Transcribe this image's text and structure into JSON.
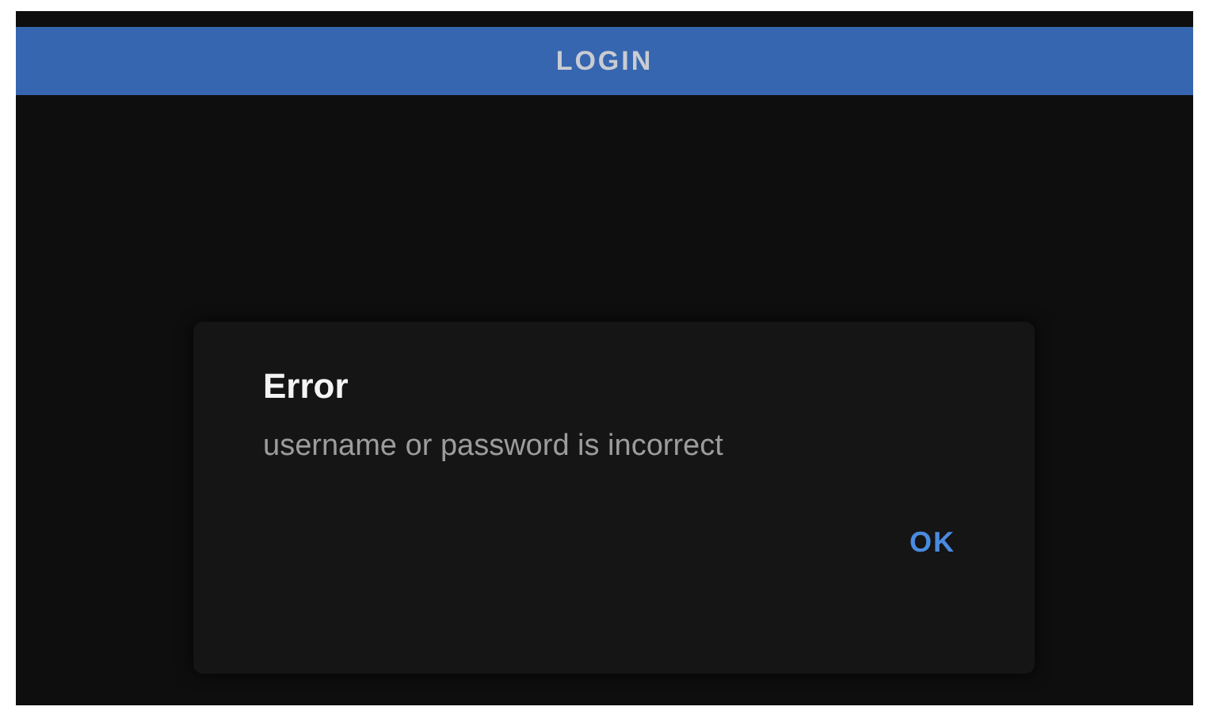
{
  "app_bar": {
    "title": "LOGIN"
  },
  "dialog": {
    "title": "Error",
    "message": "username or password is incorrect",
    "buttons": [
      "OK"
    ]
  }
}
